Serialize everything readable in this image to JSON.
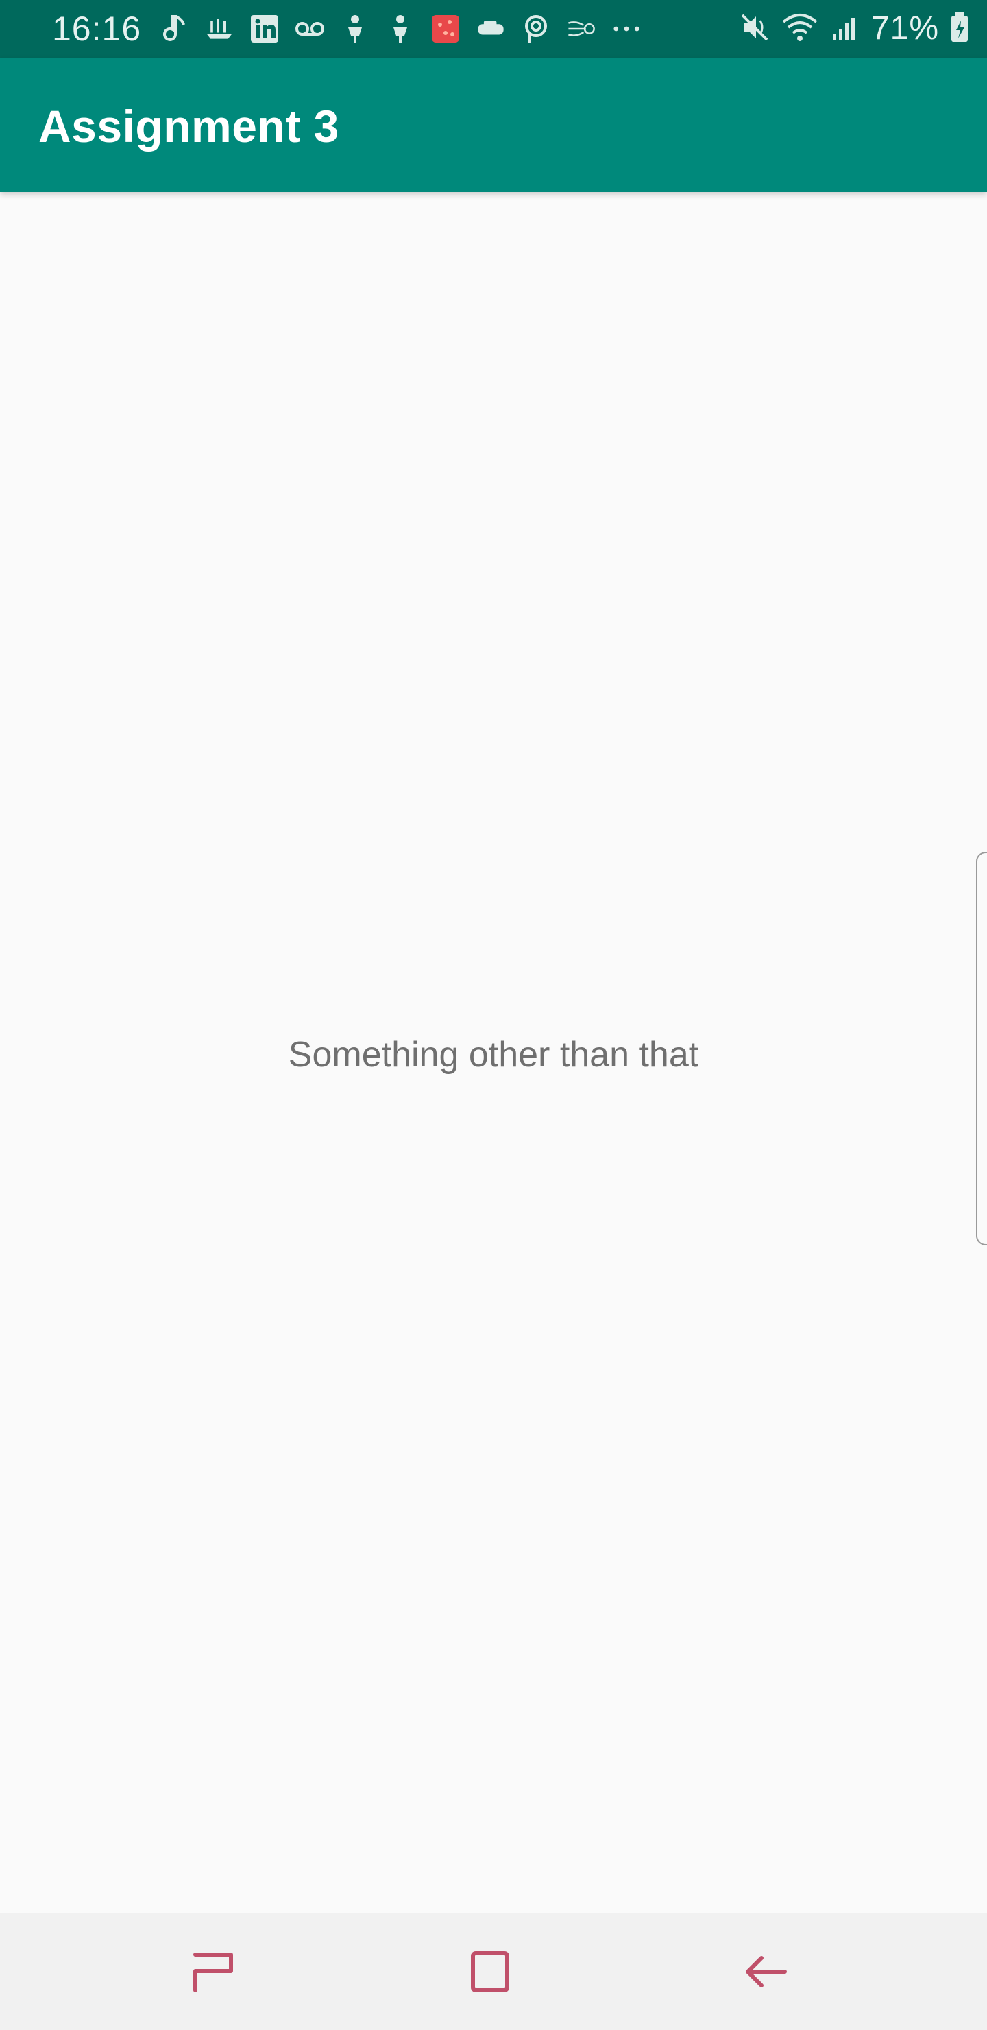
{
  "status_bar": {
    "time": "16:16",
    "battery": "71%",
    "left_icons": [
      "music-note-icon",
      "ship-icon",
      "linkedin-icon",
      "voicemail-icon",
      "person-icon",
      "person-icon",
      "app-icon",
      "truck-icon",
      "p-icon",
      "wind-icon",
      "more-icon"
    ],
    "right_icons": [
      "mute-icon",
      "wifi-icon",
      "signal-icon",
      "battery-icon"
    ]
  },
  "app_bar": {
    "title": "Assignment 3",
    "color": "#00897b",
    "status_color": "#00695c"
  },
  "content": {
    "message": "Something other than that"
  },
  "nav_bar": {
    "buttons": [
      "recents-icon",
      "home-icon",
      "back-icon"
    ],
    "accent": "#c0506a"
  }
}
